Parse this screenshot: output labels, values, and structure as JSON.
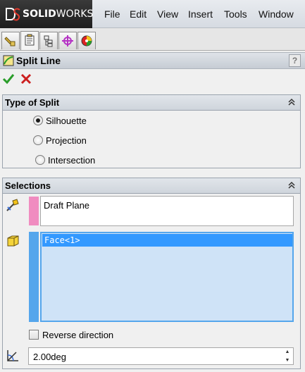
{
  "app": {
    "brand_bold": "SOLID",
    "brand_light": "WORKS"
  },
  "menu": [
    "File",
    "Edit",
    "View",
    "Insert",
    "Tools",
    "Window"
  ],
  "tabs": [
    "feature-manager-icon",
    "property-manager-icon",
    "configuration-manager-icon",
    "dimxpert-icon",
    "display-manager-icon"
  ],
  "panel": {
    "title": "Split Line",
    "help": "?"
  },
  "type_of_split": {
    "title": "Type of Split",
    "options": [
      {
        "label": "Silhouette",
        "checked": true
      },
      {
        "label": "Projection",
        "checked": false
      },
      {
        "label": "Intersection",
        "checked": false
      }
    ]
  },
  "selections": {
    "title": "Selections",
    "direction_field": "Draft Plane",
    "faces": [
      "Face<1>"
    ],
    "reverse_label": "Reverse direction",
    "angle_value": "2.00deg"
  },
  "colors": {
    "pink": "#f08cc0",
    "blue": "#55a6ec",
    "highlight": "#3399ff",
    "accept": "#2a9d2a",
    "cancel": "#cc1f1f"
  }
}
